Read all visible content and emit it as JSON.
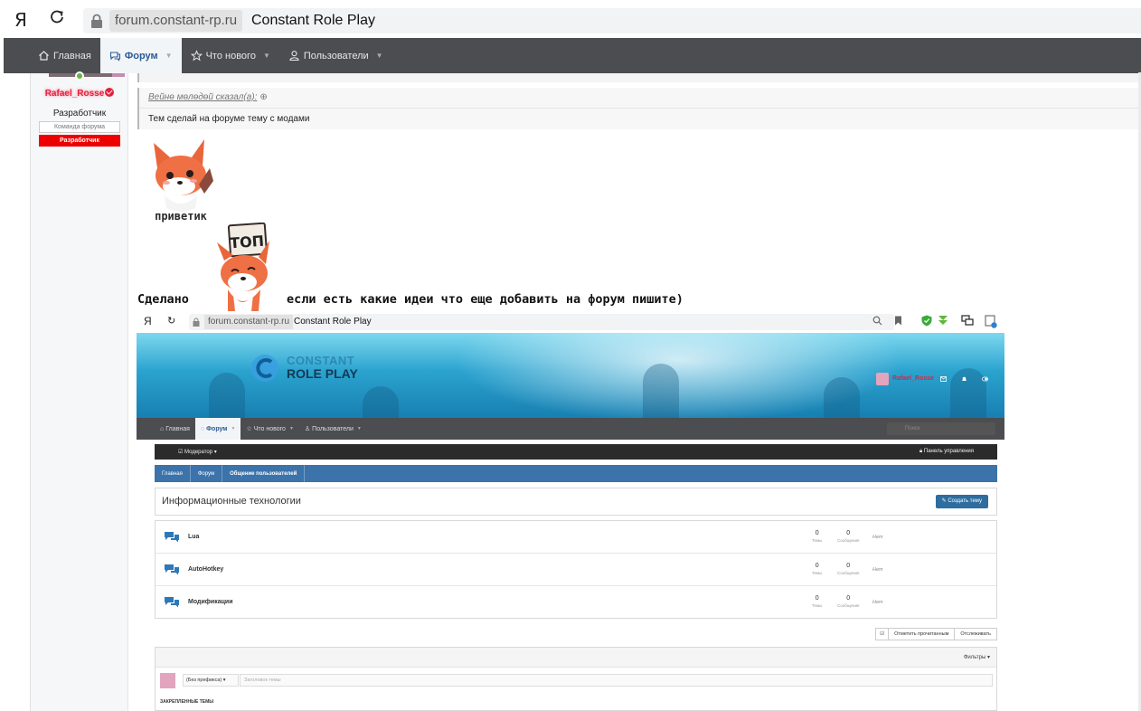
{
  "browser": {
    "logo": "Я",
    "url": "forum.constant-rp.ru",
    "title": "Constant Role Play"
  },
  "nav": {
    "tabs": [
      {
        "label": "Главная",
        "icon": "home-icon",
        "active": false
      },
      {
        "label": "Форум",
        "icon": "chat-icon",
        "active": true
      },
      {
        "label": "Что нового",
        "icon": "star-icon",
        "active": false
      },
      {
        "label": "Пользователи",
        "icon": "user-icon",
        "active": false
      }
    ]
  },
  "post_author": {
    "username": "Rafael_Rosse",
    "title": "Разработчик",
    "banner_team": "Команда форума",
    "banner_dev": "Разработчик"
  },
  "post": {
    "quote_author": "Вейнө мөлөдөй сказал(а):",
    "quote_text": "Тем сделай на форуме тему с модами",
    "sticker1_caption": "приветик",
    "sticker2_caption": "ТОП",
    "text_part1": "Сделано",
    "text_part2": "если есть какие идеи что еще добавить на форум пишите)"
  },
  "colors": {
    "nav_bg": "#4b4d50",
    "accent": "#2b5b94",
    "username": "#e0233d",
    "banner_dev": "#ee0000"
  },
  "inner_screenshot": {
    "browser": {
      "logo": "Я",
      "url": "forum.constant-rp.ru",
      "title": "Constant Role Play"
    },
    "logo_line1": "CONSTANT",
    "logo_line2": "ROLE PLAY",
    "username": "Rafael_Rosse",
    "nav": [
      "Главная",
      "Форум",
      "Что нового",
      "Пользователи"
    ],
    "search_placeholder": "Поиск",
    "mod_bar": {
      "left": "Модератор",
      "right": "Панель управления"
    },
    "breadcrumbs": [
      "Главная",
      "Форум",
      "Общение пользователей"
    ],
    "forum_title": "Информационные технологии",
    "create_button": "Создать тему",
    "stat_labels": {
      "threads": "Темы",
      "messages": "Сообщения"
    },
    "nodes": [
      {
        "title": "Lua",
        "threads": "0",
        "messages": "0",
        "last": "Нет"
      },
      {
        "title": "AutoHotkey",
        "threads": "0",
        "messages": "0",
        "last": "Нет"
      },
      {
        "title": "Модификации",
        "threads": "0",
        "messages": "0",
        "last": "Нет"
      }
    ],
    "actions": {
      "mark_read": "Отметить прочитанным",
      "watch": "Отслеживать"
    },
    "filters": "Фильтры",
    "prefix": "(Без префикса)",
    "thread_title_placeholder": "Заголовок темы",
    "pinned_label": "ЗАКРЕПЛЕННЫЕ ТЕМЫ"
  }
}
